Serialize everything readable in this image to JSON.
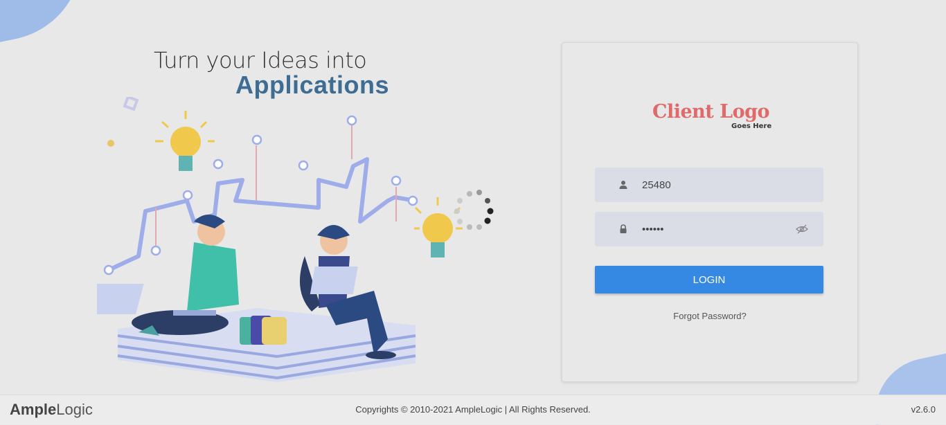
{
  "hero": {
    "line1": "Turn your Ideas into",
    "line2": "Applications"
  },
  "client_logo": {
    "main": "Client Logo",
    "sub": "Goes Here"
  },
  "login": {
    "username_value": "25480",
    "password_value": "••••••",
    "login_label": "LOGIN",
    "forgot_label": "Forgot Password?"
  },
  "footer": {
    "brand_a": "A",
    "brand_mple": "mple",
    "brand_logic": "Logic",
    "copyright": "Copyrights © 2010-2021 AmpleLogic | All Rights Reserved.",
    "version": "v2.6.0"
  },
  "icons": {
    "user": "user-icon",
    "lock": "lock-icon",
    "eye": "eye-slash-icon"
  },
  "colors": {
    "accent": "#3689e3",
    "hero_blue": "#3e6c93",
    "logo_red": "#e06a6a"
  }
}
